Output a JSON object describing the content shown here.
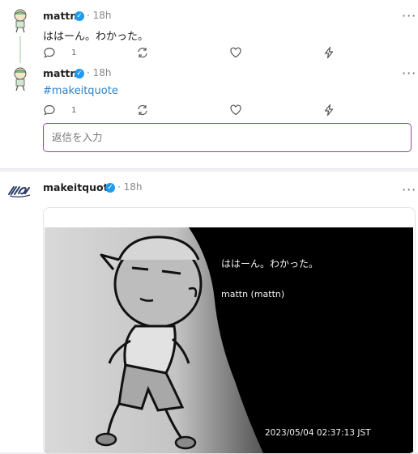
{
  "thread": {
    "post1": {
      "username": "mattn",
      "time": "18h",
      "text": "ははーん。わかった。",
      "reply_count": "1"
    },
    "post2": {
      "username": "mattn",
      "time": "18h",
      "hashtag": "#makeitquote",
      "reply_count": "1"
    },
    "reply_placeholder": "返信を入力"
  },
  "quote_post": {
    "username": "makeitquote",
    "time": "18h",
    "image": {
      "quote": "ははーん。わかった。",
      "author": "mattn (mattn)",
      "timestamp": "2023/05/04 02:37:13 JST"
    }
  },
  "colors": {
    "verified": "#1d9bf0",
    "hashtag": "#2d81c7",
    "reply_border": "#8c4b9e"
  },
  "icons": [
    "reply-icon",
    "repost-icon",
    "like-icon",
    "zap-icon",
    "more-icon",
    "verified-icon"
  ]
}
